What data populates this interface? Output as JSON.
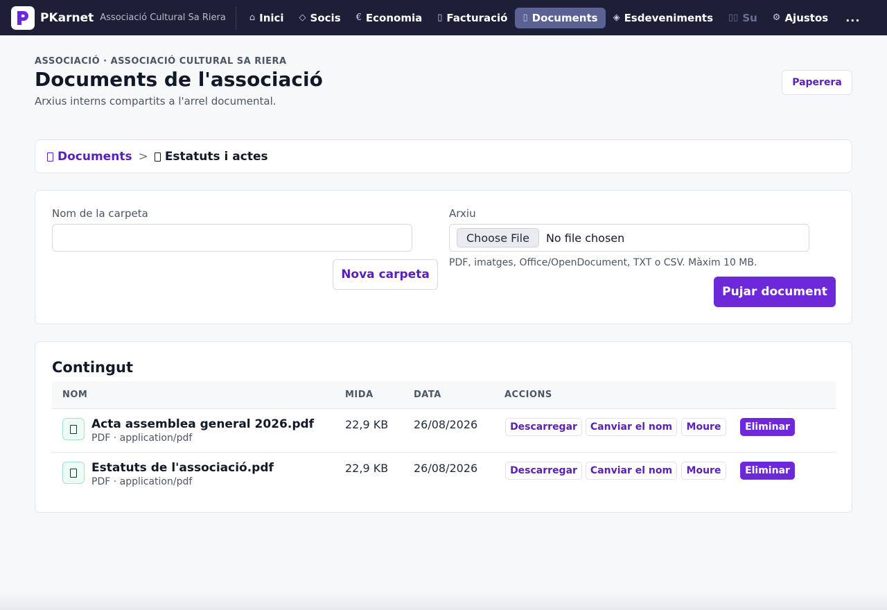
{
  "app": {
    "name": "PKarnet",
    "org": "Associació Cultural Sa Riera"
  },
  "nav": {
    "items": [
      {
        "label": "Inici",
        "icon": "⌂"
      },
      {
        "label": "Socis",
        "icon": "◇"
      },
      {
        "label": "Economia",
        "icon": "€"
      },
      {
        "label": "Facturació",
        "icon": "▯"
      },
      {
        "label": "Documents",
        "icon": "▯"
      },
      {
        "label": "Esdeveniments",
        "icon": "◈"
      },
      {
        "label": "Su",
        "icon": "▯▯"
      },
      {
        "label": "Ajustos",
        "icon": "⚙"
      }
    ],
    "active_index": 4,
    "more": "..."
  },
  "header": {
    "eyebrow": "ASSOCIACIÓ · ASSOCIACIÓ CULTURAL SA RIERA",
    "title": "Documents de l'associació",
    "subtitle": "Arxius interns compartits a l'arrel documental.",
    "trash_label": "Paperera"
  },
  "breadcrumb": {
    "root": "Documents",
    "separator": ">",
    "current": "Estatuts i actes"
  },
  "form": {
    "folder_label": "Nom de la carpeta",
    "folder_value": "",
    "new_folder_button": "Nova carpeta",
    "file_label": "Arxiu",
    "choose_file": "Choose File",
    "no_file": "No file chosen",
    "help": "PDF, imatges, Office/OpenDocument, TXT o CSV. Màxim 10 MB.",
    "upload_button": "Pujar document"
  },
  "content": {
    "title": "Contingut",
    "columns": [
      "NOM",
      "MIDA",
      "DATA",
      "ACCIONS"
    ],
    "rows": [
      {
        "name": "Acta assemblea general 2026.pdf",
        "meta": "PDF · application/pdf",
        "size": "22,9 KB",
        "date": "26/08/2026"
      },
      {
        "name": "Estatuts de l'associació.pdf",
        "meta": "PDF · application/pdf",
        "size": "22,9 KB",
        "date": "26/08/2026"
      }
    ],
    "actions": {
      "download": "Descarregar",
      "rename": "Canviar el nom",
      "move": "Moure",
      "delete": "Eliminar"
    }
  },
  "colors": {
    "navbar": "#1c1f36",
    "nav_active": "#5b6193",
    "accent": "#6d28d9",
    "link": "#5b21b6"
  }
}
